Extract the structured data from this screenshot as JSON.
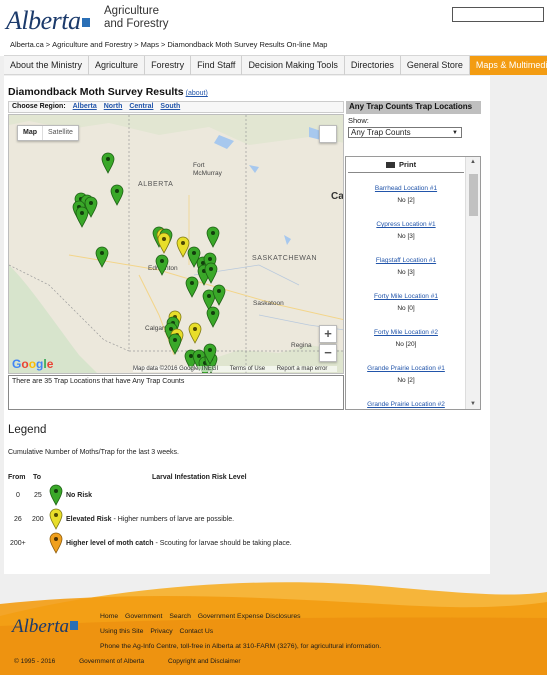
{
  "header": {
    "logo_text": "Alberta",
    "ministry_line1": "Agriculture",
    "ministry_line2": "and Forestry",
    "search_value": ""
  },
  "breadcrumb": [
    "Alberta.ca",
    "Agriculture and Forestry",
    "Maps",
    "Diamondback Moth Survey Results On-line Map"
  ],
  "nav": [
    "About the Ministry",
    "Agriculture",
    "Forestry",
    "Find Staff",
    "Decision Making Tools",
    "Directories",
    "General Store",
    "Maps & Multimedia"
  ],
  "page": {
    "title": "Diamondback Moth Survey Results",
    "about_link": "(about)",
    "choose_region_label": "Choose Region:",
    "regions": [
      "Alberta",
      "North",
      "Central",
      "South"
    ]
  },
  "map": {
    "toggle_map": "Map",
    "toggle_satellite": "Satellite",
    "zoom_in": "+",
    "zoom_out": "−",
    "labels": {
      "alberta": "ALBERTA",
      "saskatchewan": "SASKATCHEWAN",
      "fort_mcmurray": "Fort McMurray",
      "edmonton": "Edmonton",
      "saskatoon": "Saskatoon",
      "calgary": "Calgary",
      "regina": "Regina",
      "canada_partial": "Ca"
    },
    "attribution": "Map data ©2016 Google, INEGI",
    "terms": "Terms of Use",
    "report": "Report a map error",
    "google_logo": "Google"
  },
  "status_text": "There are 35 Trap Locations that have Any Trap Counts",
  "side_panel": {
    "heading": "Any Trap Counts Trap Locations",
    "show_label": "Show:",
    "show_value": "Any Trap Counts",
    "print_label": "Print",
    "locations": [
      {
        "name": "Barrhead Location #1",
        "count": "No [2]"
      },
      {
        "name": "Cypress Location #1",
        "count": "No [3]"
      },
      {
        "name": "Flagstaff Location #1",
        "count": "No [3]"
      },
      {
        "name": "Forty Mile Location #1",
        "count": "No [0]"
      },
      {
        "name": "Forty Mile Location #2",
        "count": "No [20]"
      },
      {
        "name": "Grande Prairie Location #1",
        "count": "No [2]"
      },
      {
        "name": "Grande Prairie Location #2",
        "count": ""
      }
    ]
  },
  "legend": {
    "title": "Legend",
    "description": "Cumulative Number of Moths/Trap for the last 3 weeks.",
    "col_from": "From",
    "col_to": "To",
    "col_risk": "Larval Infestation Risk Level",
    "rows": [
      {
        "from": "0",
        "to": "25",
        "label": "No Risk",
        "detail": "",
        "color": "#3aa829"
      },
      {
        "from": "26",
        "to": "200",
        "label": "Elevated Risk",
        "detail": " - Higher numbers of larve are possible.",
        "color": "#e8de2a"
      },
      {
        "from": "200+",
        "to": "",
        "label": "Higher level of moth catch",
        "detail": " - Scouting for larvae should be taking place.",
        "color": "#f0a01e"
      }
    ]
  },
  "footer": {
    "logo_text": "Alberta",
    "links1": [
      "Home",
      "Government",
      "Search",
      "Government Expense Disclosures"
    ],
    "links2": [
      "Using this Site",
      "Privacy",
      "Contact Us"
    ],
    "phone_text": "Phone the Ag-Info Centre, toll-free in Alberta at 310-FARM (3276), for agricultural information.",
    "copyright": "© 1995 - 2016",
    "gov": "Government of Alberta",
    "copy_link": "Copyright and Disclaimer"
  },
  "colors": {
    "accent": "#f39c12",
    "green_pin": "#3aa829",
    "yellow_pin": "#e8de2a",
    "orange_pin": "#f0a01e"
  }
}
